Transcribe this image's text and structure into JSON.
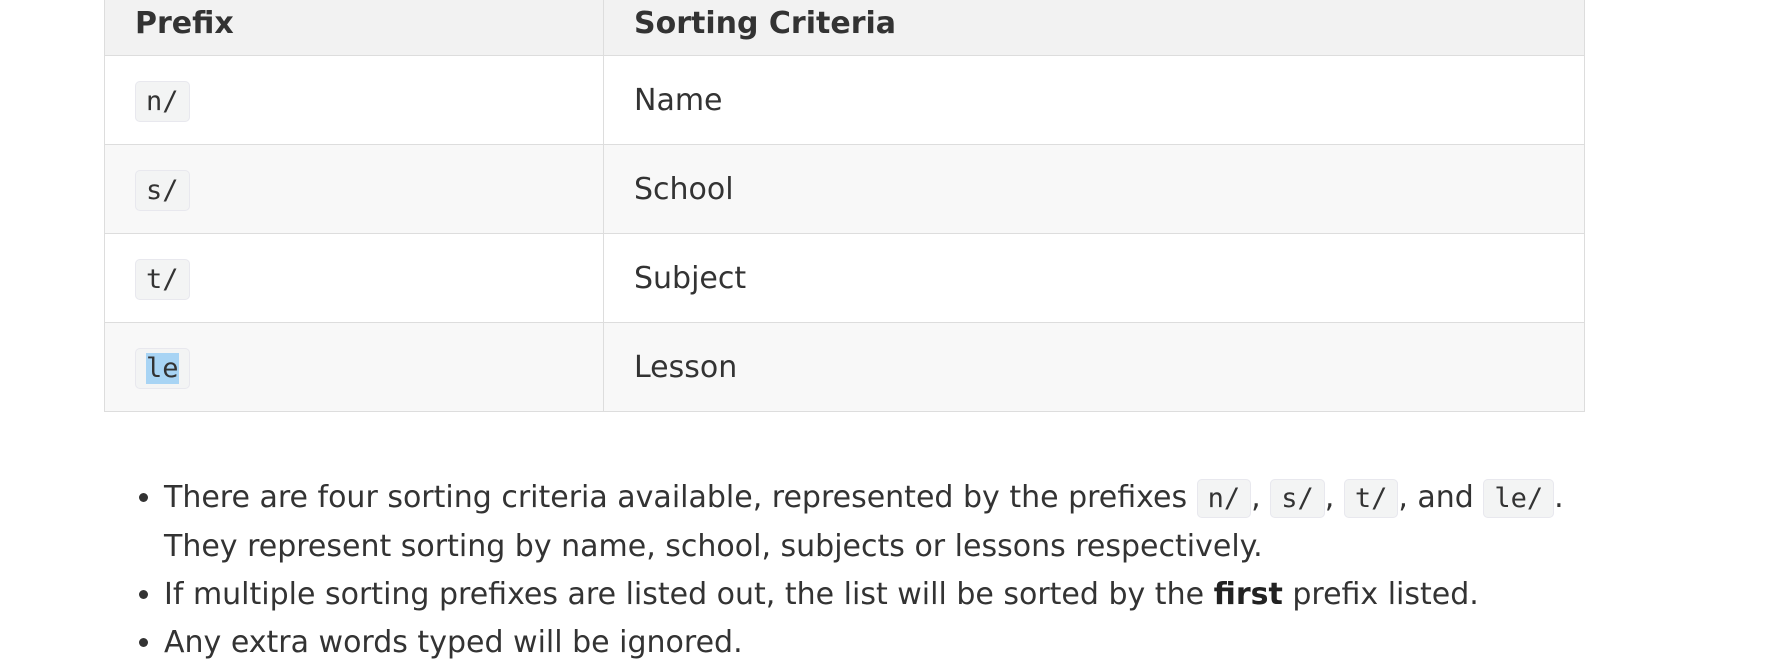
{
  "table": {
    "headers": [
      "Prefix",
      "Sorting Criteria"
    ],
    "rows": [
      {
        "prefix": "n/",
        "criteria": "Name"
      },
      {
        "prefix": "s/",
        "criteria": "School"
      },
      {
        "prefix": "t/",
        "criteria": "Subject"
      },
      {
        "prefix": "le",
        "criteria": "Lesson"
      }
    ]
  },
  "notes": {
    "item1": {
      "text_before": "There are four sorting criteria available, represented by the prefixes ",
      "code1": "n/",
      "sep1": ", ",
      "code2": "s/",
      "sep2": ", ",
      "code3": "t/",
      "sep3": ", and ",
      "code4": "le/",
      "text_after": ". They represent sorting by name, school, subjects or lessons respectively."
    },
    "item2": {
      "text_before": "If multiple sorting prefixes are listed out, the list will be sorted by the ",
      "bold": "first",
      "text_after": " prefix listed."
    },
    "item3": {
      "text": "Any extra words typed will be ignored."
    }
  },
  "colors": {
    "header_bg": "#f2f2f2",
    "row_alt_bg": "#f8f8f8",
    "border": "#dddddd",
    "selection": "#a8d4f4",
    "code_bg": "#f3f4f4"
  }
}
